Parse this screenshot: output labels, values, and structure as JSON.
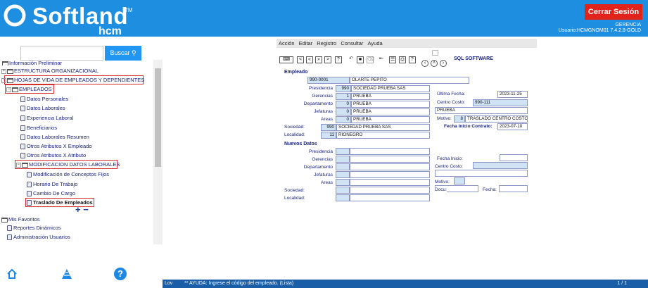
{
  "header": {
    "logo_text": "Softland",
    "logo_tm": "TM",
    "logo_sub": "hcm",
    "logout_label": "Cerrar Sesión",
    "role": "GERENCIA",
    "user_info": "Usuario:HCMGNOM01 7.4.2.8-GOLD"
  },
  "sidebar": {
    "search_label": "Buscar",
    "tree_header": "Información Preliminar",
    "tree": [
      {
        "label": "ESTRUCTURA ORGANIZACIONAL"
      },
      {
        "label": "HOJAS DE VIDA DE EMPLEADOS Y DEPENDIENTES"
      },
      {
        "label": "EMPLEADOS"
      },
      {
        "label": "Datos Personales"
      },
      {
        "label": "Datos Laborales"
      },
      {
        "label": "Experiencia Laboral"
      },
      {
        "label": "Beneficiarios"
      },
      {
        "label": "Datos Laborales Resumen"
      },
      {
        "label": "Otros Atributos X Empleado"
      },
      {
        "label": "Otros Atributos X Atributo"
      },
      {
        "label": "MODIFICACION DATOS LABORALES"
      },
      {
        "label": "Modificación de Conceptos Fijos"
      },
      {
        "label": "Horario De Trabajo"
      },
      {
        "label": "Cambio De Cargo"
      },
      {
        "label": "Traslado De Empleados"
      }
    ],
    "plus_minus": "+ −",
    "favorites": {
      "title": "Mis Favoritos",
      "items": [
        "Reportes Dinámicos",
        "Administración Usuarios"
      ]
    },
    "bottom_icons": [
      "home-icon",
      "pyramid-icon",
      "help-icon"
    ],
    "help_symbol": "?"
  },
  "menubar": {
    "items": [
      "Acción",
      "Editar",
      "Registro",
      "Consultar",
      "Ayuda"
    ]
  },
  "toolbar": {
    "sql_label": "SQL SOFTWARE"
  },
  "form": {
    "empleado_section": "Empleado",
    "empleado_code": "990-0001",
    "empleado_name": "OLARTE  PEPITO",
    "labels": {
      "presidencia": "Presidencia",
      "gerencias": "Gerencias",
      "departamento": "Departamento",
      "jefaturas": "Jefaturas",
      "areas": "Areas",
      "sociedad": "Sociedad:",
      "localidad": "Localidad:",
      "ultima_fecha": "Última Fecha:",
      "centro_costo": "Centro Costo:",
      "motivo": "Motivo:",
      "fecha_inicio_contrato": "Fecha inicio Contrato:",
      "fecha_inicio": "Fecha Inicio:",
      "docu": "Docu:",
      "fecha": "Fecha:"
    },
    "presidencia": {
      "code": "990",
      "name": "SOCIEDAD  PRUEBA SAS"
    },
    "gerencias": {
      "code": "1",
      "name": "PRUEBA"
    },
    "departamento": {
      "code": "0",
      "name": "PRUEBA"
    },
    "jefaturas": {
      "code": "0",
      "name": "PRUEBA"
    },
    "areas": {
      "code": "0",
      "name": "PRUEBA"
    },
    "sociedad": {
      "code": "990",
      "name": "SOCIEDAD  PRUEBA SAS"
    },
    "localidad": {
      "code": "11",
      "name": "RIONEGRO"
    },
    "ultima_fecha": "2023-11-25",
    "centro_costo_code": "990-111",
    "centro_costo_name": "PRUEBA",
    "motivo_code": "8",
    "motivo_name": "TRASLADO CENTRO COSTO",
    "fecha_inicio_contrato": "2023-07-10",
    "nuevos_section": "Nuevos Datos"
  },
  "status": {
    "lov": "Lov",
    "message": "** AYUDA: Ingrese el código del empleado. (Lista)",
    "page": "1 / 1"
  },
  "colors": {
    "header_blue": "#1e8fe0",
    "logout_red": "#e2231a",
    "status_blue": "#1a5ea8",
    "highlight_red": "#d32f2f",
    "field_blue": "#cfe3f5"
  }
}
